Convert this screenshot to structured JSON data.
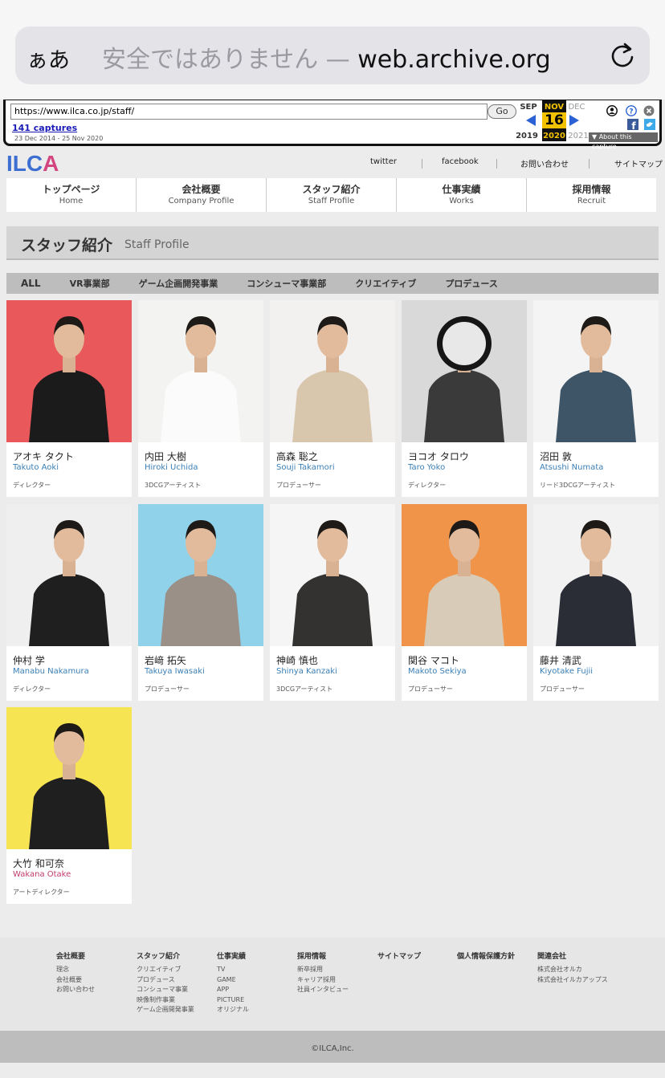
{
  "browser": {
    "aa_label": "ぁあ",
    "insecure_label": "安全ではありません —",
    "domain": "web.archive.org"
  },
  "wayback": {
    "url": "https://www.ilca.co.jp/staff/",
    "go_label": "Go",
    "captures": "141 captures",
    "range": "23 Dec 2014 - 25 Nov 2020",
    "prev_month": "SEP",
    "cur_month": "NOV",
    "next_month": "DEC",
    "day": "16",
    "prev_year": "2019",
    "cur_year": "2020",
    "next_year": "2021",
    "about": "About this capture"
  },
  "site": {
    "logo": {
      "l1": "I",
      "l2": "L",
      "l3": "C",
      "l4": "A"
    },
    "toplinks": [
      "twitter",
      "facebook",
      "お問い合わせ",
      "サイトマップ"
    ],
    "nav": [
      {
        "jp": "トップページ",
        "en": "Home"
      },
      {
        "jp": "会社概要",
        "en": "Company Profile"
      },
      {
        "jp": "スタッフ紹介",
        "en": "Staff Profile"
      },
      {
        "jp": "仕事実績",
        "en": "Works"
      },
      {
        "jp": "採用情報",
        "en": "Recruit"
      }
    ],
    "title_jp": "スタッフ紹介",
    "title_en": "Staff Profile",
    "filters": [
      "ALL",
      "VR事業部",
      "ゲーム企画開発事業",
      "コンシューマ事業部",
      "クリエイティブ",
      "プロデュース"
    ]
  },
  "staff": [
    {
      "jp": "アオキ タクト",
      "en": "Takuto Aoki",
      "role": "ディレクター",
      "bg": "#e9585a",
      "shirt": "#1b1b1b"
    },
    {
      "jp": "内田 大樹",
      "en": "Hiroki Uchida",
      "role": "3DCGアーティスト",
      "bg": "#f3f3f1",
      "shirt": "#fbfbfb"
    },
    {
      "jp": "高森 聡之",
      "en": "Souji Takamori",
      "role": "プロデューサー",
      "bg": "#f2f1ef",
      "shirt": "#d8c6ad"
    },
    {
      "jp": "ヨコオ タロウ",
      "en": "Taro Yoko",
      "role": "ディレクター",
      "bg": "#d9d9d9",
      "shirt": "#3a3a3a"
    },
    {
      "jp": "沼田 敦",
      "en": "Atsushi Numata",
      "role": "リード3DCGアーティスト",
      "bg": "#f4f4f4",
      "shirt": "#3e5568"
    },
    {
      "jp": "仲村 学",
      "en": "Manabu Nakamura",
      "role": "ディレクター",
      "bg": "#efefef",
      "shirt": "#1f1f1f"
    },
    {
      "jp": "岩﨑 拓矢",
      "en": "Takuya Iwasaki",
      "role": "プロデューサー",
      "bg": "#8fd2ea",
      "shirt": "#9a9088"
    },
    {
      "jp": "神崎 慎也",
      "en": "Shinya Kanzaki",
      "role": "3DCGアーティスト",
      "bg": "#f5f5f5",
      "shirt": "#333230"
    },
    {
      "jp": "関谷 マコト",
      "en": "Makoto Sekiya",
      "role": "プロデューサー",
      "bg": "#f0944a",
      "shirt": "#d8cbb7"
    },
    {
      "jp": "藤井 清武",
      "en": "Kiyotake Fujii",
      "role": "プロデューサー",
      "bg": "#f2f2f2",
      "shirt": "#2a2d36"
    },
    {
      "jp": "大竹 和可奈",
      "en": "Wakana Otake",
      "role": "アートディレクター",
      "bg": "#f7e453",
      "shirt": "#1f1f1f"
    }
  ],
  "footer": {
    "cols": [
      {
        "head": "会社概要",
        "links": [
          "理念",
          "会社概要",
          "お問い合わせ"
        ]
      },
      {
        "head": "スタッフ紹介",
        "links": [
          "クリエイティブ",
          "プロデュース",
          "コンシューマ事業",
          "映像制作事業",
          "ゲーム企画開発事業"
        ]
      },
      {
        "head": "仕事実績",
        "links": [
          "TV",
          "GAME",
          "APP",
          "PICTURE",
          "オリジナル"
        ]
      },
      {
        "head": "採用情報",
        "links": [
          "新卒採用",
          "キャリア採用",
          "社員インタビュー"
        ]
      },
      {
        "head": "サイトマップ",
        "links": []
      },
      {
        "head": "個人情報保護方針",
        "links": []
      },
      {
        "head": "関連会社",
        "links": [
          "株式会社オルカ",
          "株式会社イルカアップス"
        ]
      }
    ],
    "copyright": "©ILCA,Inc."
  },
  "colors": {
    "logo_blue": "#3c6fd1",
    "logo_pink": "#d2457e",
    "name_blue": "#3a7fb6",
    "name_pink": "#c23b6e"
  }
}
